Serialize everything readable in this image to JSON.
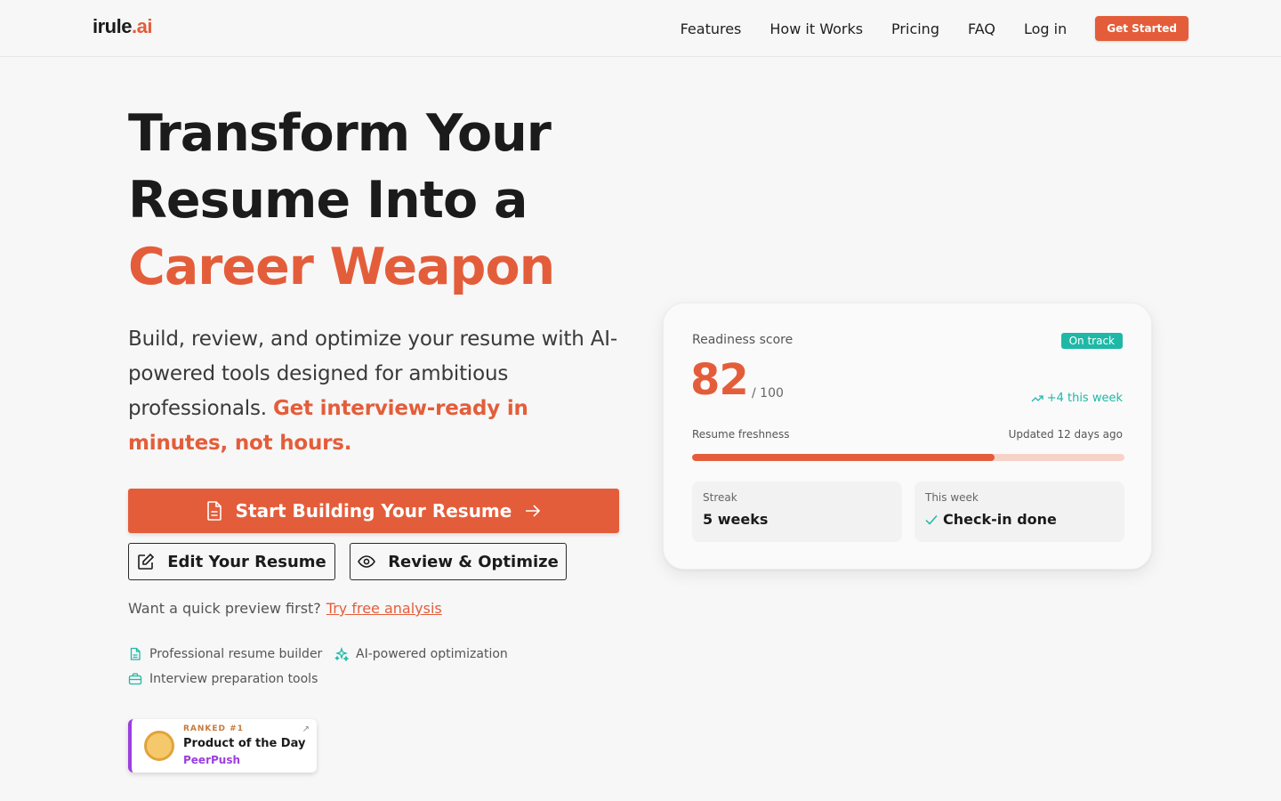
{
  "brand": {
    "logo_dark": "irule",
    "logo_accent": ".ai",
    "accent_color": "#e45d3a",
    "teal_color": "#1fb8a6"
  },
  "nav": {
    "items": [
      "Features",
      "How it Works",
      "Pricing",
      "FAQ",
      "Log in"
    ],
    "cta": "Get Started"
  },
  "hero": {
    "title_line1": "Transform Your",
    "title_line2": "Resume Into a",
    "title_line3": "Career Weapon",
    "desc_main": "Build, review, and optimize your resume with AI-powered tools designed for ambitious professionals. ",
    "desc_accent": "Get interview-ready in minutes, not hours.",
    "primary_button": "Start Building Your Resume",
    "edit_button": "Edit Your Resume",
    "review_button": "Review & Optimize",
    "preview_text": "Want a quick preview first?",
    "preview_link": "Try free analysis",
    "features": [
      "Professional resume builder",
      "AI-powered optimization",
      "Interview preparation tools"
    ]
  },
  "badge": {
    "ranked": "RANKED #1",
    "title": "Product of the Day",
    "source": "PeerPush"
  },
  "card": {
    "readiness_label": "Readiness score",
    "status": "On track",
    "score": "82",
    "max": "/ 100",
    "delta": "+4 this week",
    "freshness_label": "Resume freshness",
    "updated": "Updated 12 days ago",
    "freshness_percent": 70,
    "streak_label": "Streak",
    "streak_value": "5 weeks",
    "week_label": "This week",
    "week_value": "Check-in done"
  }
}
